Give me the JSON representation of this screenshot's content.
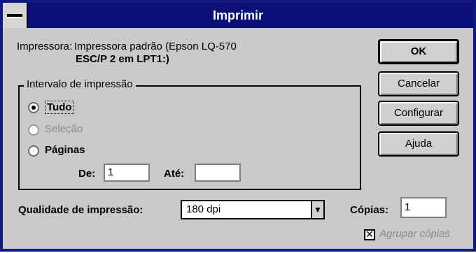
{
  "window": {
    "title": "Imprimir"
  },
  "printer": {
    "label": "Impressora:",
    "line1": "Impressora padrão (Epson LQ-570",
    "line2": "ESC/P 2 em LPT1:)"
  },
  "buttons": {
    "ok": "OK",
    "cancel": "Cancelar",
    "configure": "Configurar",
    "help": "Ajuda"
  },
  "range": {
    "legend": "Intervalo de impressão",
    "all": "Tudo",
    "selection": "Seleção",
    "pages": "Páginas",
    "from_label": "De:",
    "from_value": "1",
    "to_label": "Até:",
    "to_value": ""
  },
  "quality": {
    "label": "Qualidade de impressão:",
    "value": "180 dpi"
  },
  "copies": {
    "label": "Cópias:",
    "value": "1"
  },
  "collate": {
    "label": "Agrupar cópias"
  }
}
